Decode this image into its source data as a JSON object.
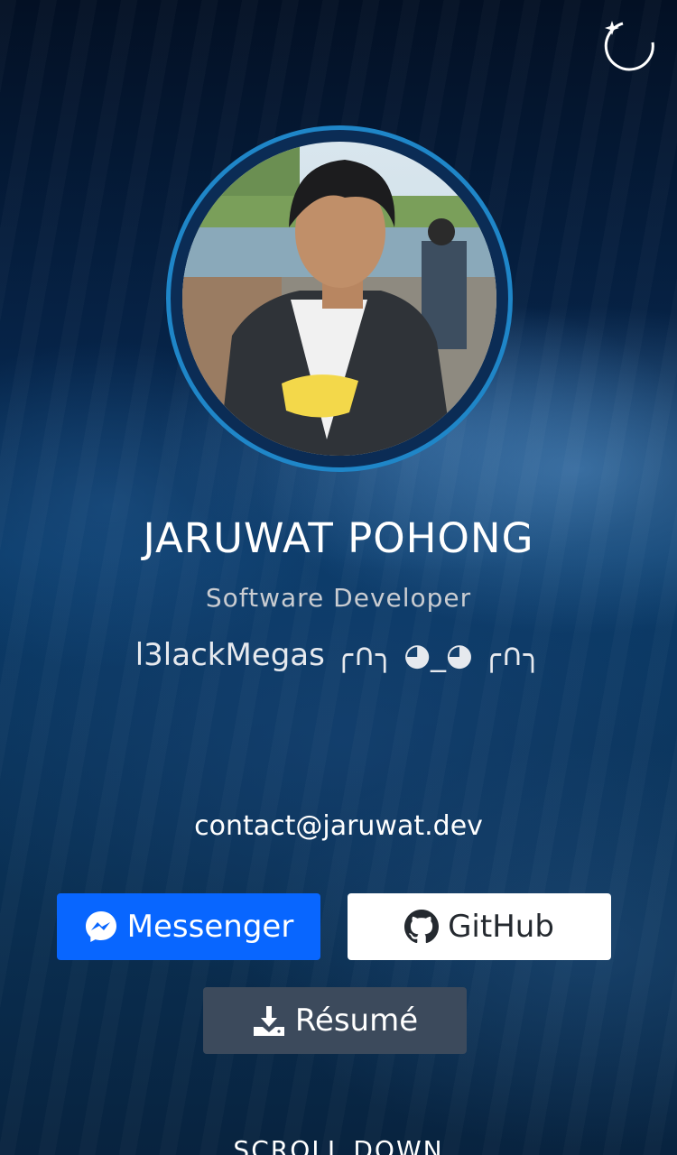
{
  "profile": {
    "name": "JARUWAT POHONG",
    "role": "Software Developer",
    "handle": "l3lackMegas ╭∩╮ ◕_◕ ╭∩╮",
    "email": "contact@jaruwat.dev",
    "avatar_icon": "profile-photo"
  },
  "header": {
    "theme_toggle_icon": "moon-sparkle-icon"
  },
  "buttons": {
    "messenger_label": "Messenger",
    "github_label": "GitHub",
    "resume_label": "Résumé"
  },
  "footer": {
    "scroll_down": "SCROLL DOWN"
  },
  "colors": {
    "messenger_blue": "#0866ff",
    "ring_blue": "#1f86c8",
    "resume_gray": "#3c4a5c",
    "github_white": "#ffffff"
  }
}
